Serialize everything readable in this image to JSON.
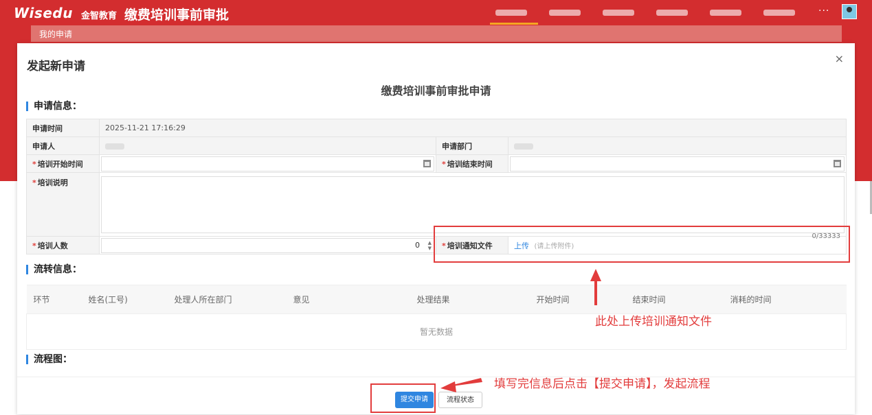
{
  "header": {
    "logo_text": "Wisedu",
    "logo_sub": "金智教育",
    "app_title": "缴费培训事前审批",
    "nav_count": 6,
    "more": "···"
  },
  "tabstrip": {
    "active_tab": "我的申请"
  },
  "dialog": {
    "title": "发起新申请",
    "close": "×",
    "form_title": "缴费培训事前审批申请"
  },
  "sections": {
    "apply_info": "申请信息：",
    "flow_info": "流转信息：",
    "flow_chart": "流程图："
  },
  "form": {
    "apply_time_label": "申请时间",
    "apply_time_value": "2025-11-21 17:16:29",
    "applicant_label": "申请人",
    "dept_label": "申请部门",
    "start_label": "培训开始时间",
    "end_label": "培训结束时间",
    "desc_label": "培训说明",
    "desc_counter": "0/33333",
    "count_label": "培训人数",
    "count_value": "0",
    "file_label": "培训通知文件",
    "upload_link": "上传",
    "upload_hint": "(请上传附件)",
    "required_mark": "*"
  },
  "flow_table": {
    "columns": [
      "环节",
      "姓名(工号)",
      "处理人所在部门",
      "意见",
      "处理结果",
      "开始时间",
      "结束时间",
      "消耗的时间"
    ],
    "empty_text": "暂无数据"
  },
  "buttons": {
    "submit": "提交申请",
    "status": "流程状态"
  },
  "annotations": {
    "upload_note": "此处上传培训通知文件",
    "submit_note": "填写完信息后点击【提交申请】，发起流程",
    "color": "#e23c3c"
  },
  "colors": {
    "brand_red": "#d32d2f",
    "primary_blue": "#2f86e0"
  }
}
